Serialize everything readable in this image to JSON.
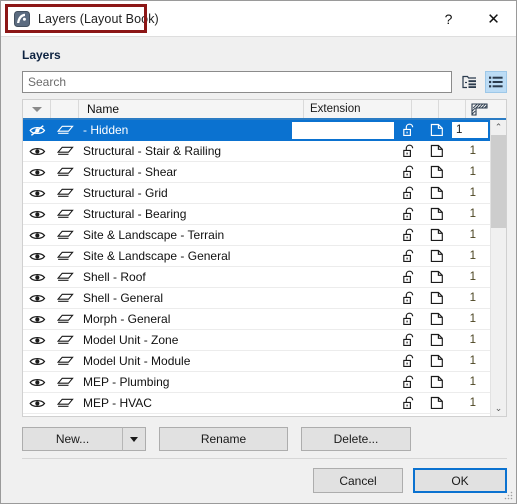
{
  "window": {
    "title": "Layers (Layout Book)",
    "app_icon": "archicad-layers-icon",
    "help_label": "?",
    "close_label": "✕",
    "annotation_color": "#8c1616"
  },
  "panel": {
    "section_label": "Layers"
  },
  "search": {
    "value": "",
    "placeholder": "Search",
    "tree_view_icon": "tree-view-icon",
    "list_view_icon": "list-view-icon",
    "active_view": "list"
  },
  "table": {
    "columns": [
      {
        "key": "sort",
        "label": "",
        "icon": "sort-caret-icon"
      },
      {
        "key": "layer",
        "label": ""
      },
      {
        "key": "name",
        "label": "Name"
      },
      {
        "key": "extension",
        "label": "Extension"
      },
      {
        "key": "lock",
        "label": ""
      },
      {
        "key": "sheet",
        "label": ""
      },
      {
        "key": "intersection",
        "label": "",
        "icon": "hatch-pattern-icon"
      }
    ],
    "rows": [
      {
        "name": "- Hidden",
        "extension": "",
        "number": "1",
        "visible": false,
        "selected": true
      },
      {
        "name": "Structural - Stair & Railing",
        "extension": "",
        "number": "1",
        "visible": true,
        "selected": false
      },
      {
        "name": "Structural - Shear",
        "extension": "",
        "number": "1",
        "visible": true,
        "selected": false
      },
      {
        "name": "Structural - Grid",
        "extension": "",
        "number": "1",
        "visible": true,
        "selected": false
      },
      {
        "name": "Structural - Bearing",
        "extension": "",
        "number": "1",
        "visible": true,
        "selected": false
      },
      {
        "name": "Site & Landscape - Terrain",
        "extension": "",
        "number": "1",
        "visible": true,
        "selected": false
      },
      {
        "name": "Site & Landscape - General",
        "extension": "",
        "number": "1",
        "visible": true,
        "selected": false
      },
      {
        "name": "Shell - Roof",
        "extension": "",
        "number": "1",
        "visible": true,
        "selected": false
      },
      {
        "name": "Shell - General",
        "extension": "",
        "number": "1",
        "visible": true,
        "selected": false
      },
      {
        "name": "Morph - General",
        "extension": "",
        "number": "1",
        "visible": true,
        "selected": false
      },
      {
        "name": "Model Unit - Zone",
        "extension": "",
        "number": "1",
        "visible": true,
        "selected": false
      },
      {
        "name": "Model Unit - Module",
        "extension": "",
        "number": "1",
        "visible": true,
        "selected": false
      },
      {
        "name": "MEP - Plumbing",
        "extension": "",
        "number": "1",
        "visible": true,
        "selected": false
      },
      {
        "name": "MEP - HVAC",
        "extension": "",
        "number": "1",
        "visible": true,
        "selected": false
      }
    ],
    "scrollbar": {
      "up_arrow": "⌃",
      "down_arrow": "⌄"
    }
  },
  "actions": {
    "new_label": "New...",
    "new_dropdown_icon": "chevron-down-icon",
    "rename_label": "Rename",
    "delete_label": "Delete..."
  },
  "footer": {
    "cancel_label": "Cancel",
    "ok_label": "OK",
    "accent_color": "#0b72d0"
  }
}
